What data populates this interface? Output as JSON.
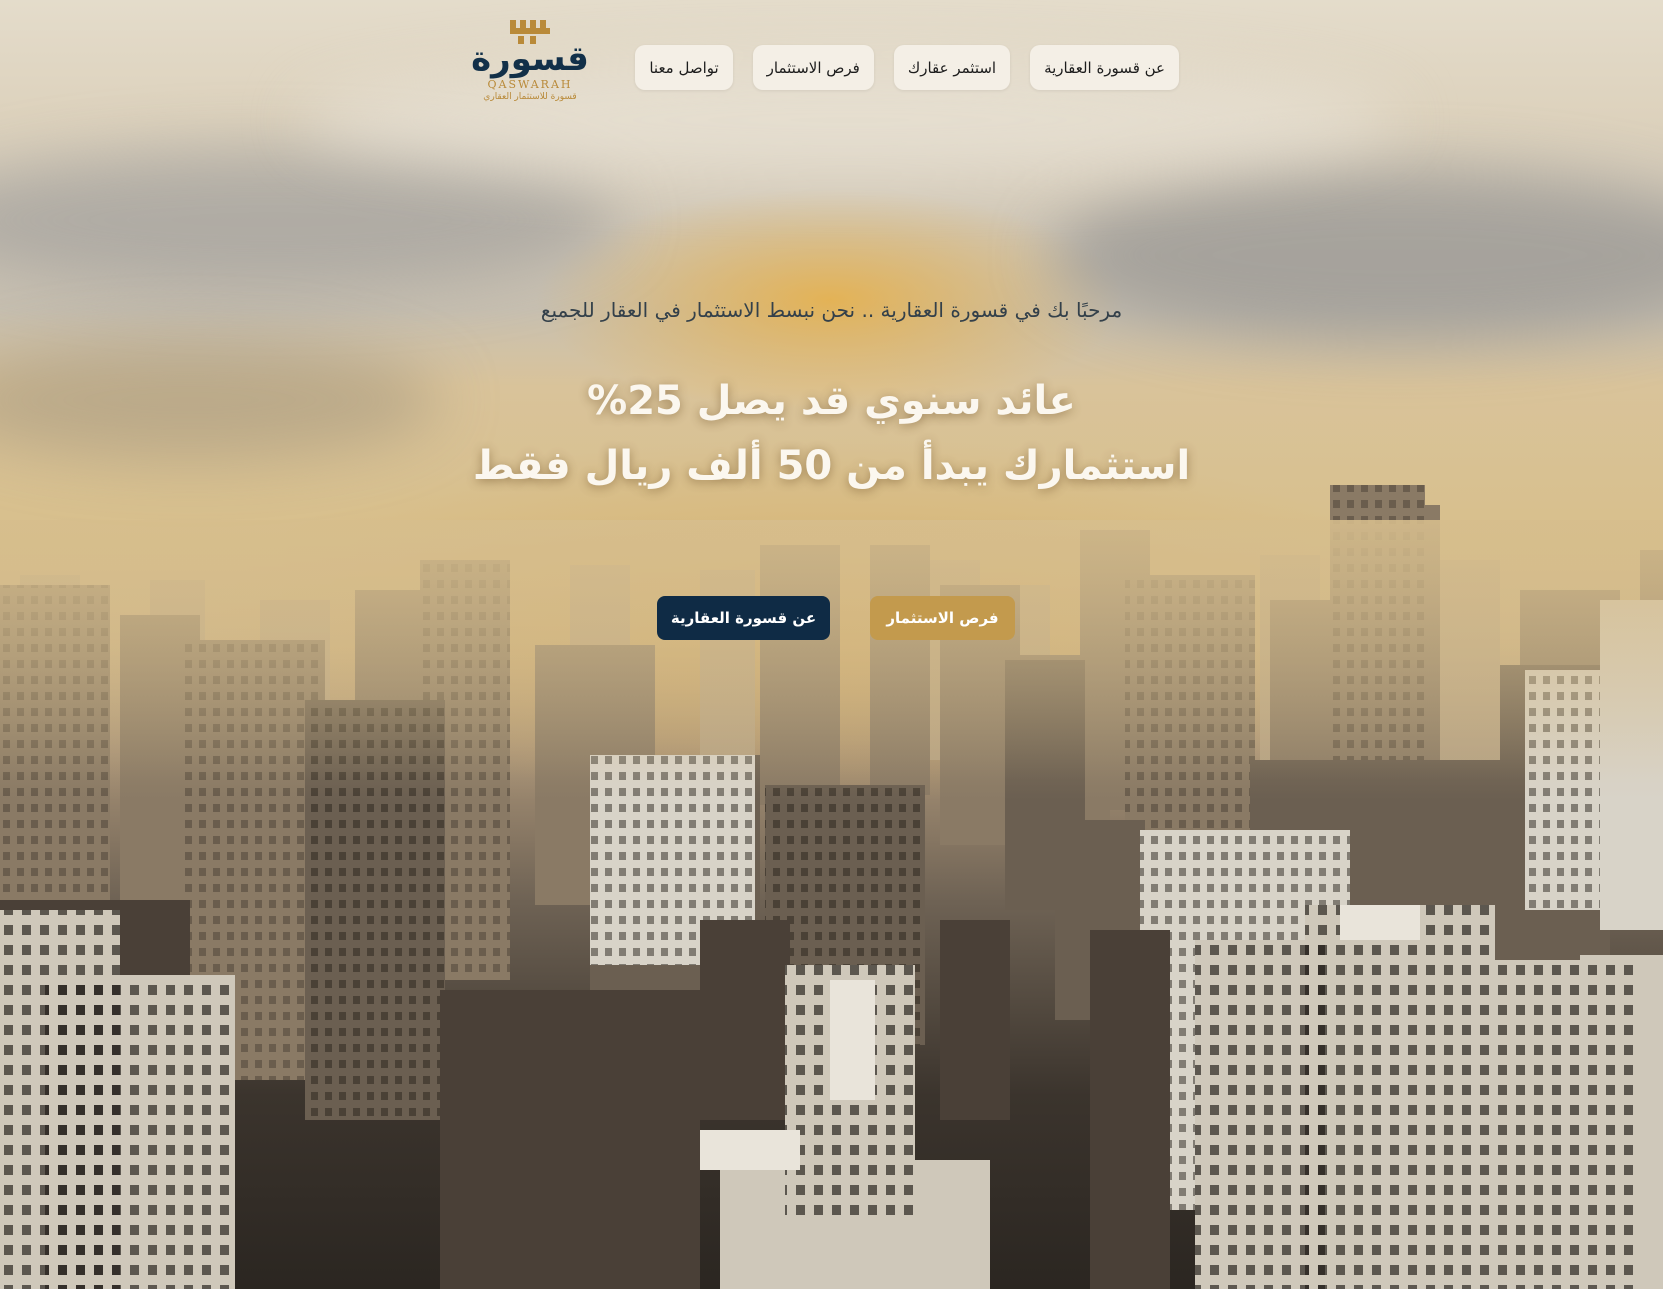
{
  "brand": {
    "name_ar": "قسورة",
    "name_en": "QASWARAH",
    "tagline": "قسورة للاستثمار العقاري",
    "colors": {
      "navy": "#123049",
      "gold": "#b98a39"
    }
  },
  "nav": {
    "items": [
      {
        "label": "عن قسورة العقارية"
      },
      {
        "label": "استثمر عقارك"
      },
      {
        "label": "فرص الاستثمار"
      },
      {
        "label": "تواصل معنا"
      }
    ]
  },
  "hero": {
    "tagline": "مرحبًا بك في قسورة العقارية .. نحن نبسط الاستثمار في العقار للجميع",
    "headline_line1": "عائد سنوي قد يصل 25%",
    "headline_line2": "استثمارك يبدأ من 50 ألف ريال فقط",
    "primary_cta": "فرص الاستثمار",
    "secondary_cta": "عن قسورة العقارية",
    "background": "city-skyline-photo"
  }
}
